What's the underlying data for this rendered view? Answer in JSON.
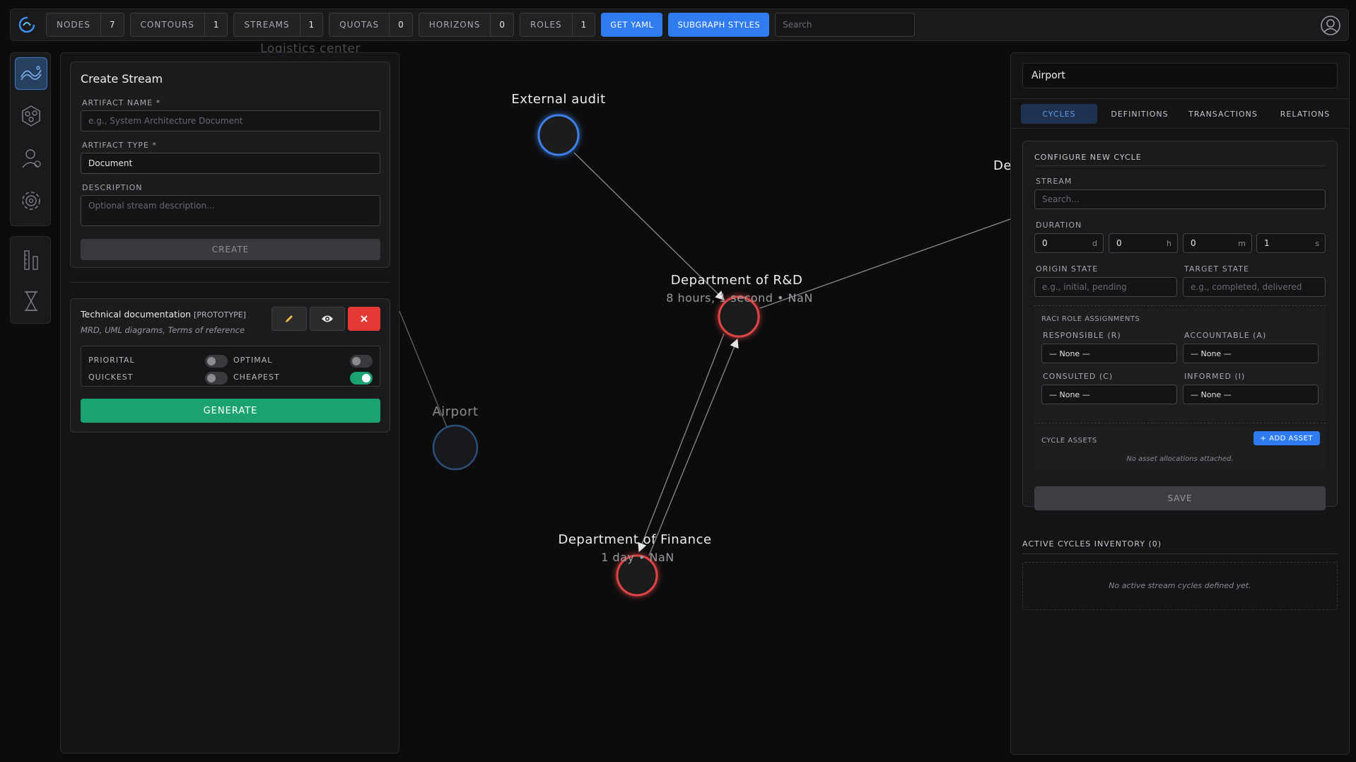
{
  "toolbar": {
    "pills": [
      {
        "label": "NODES",
        "count": "7"
      },
      {
        "label": "CONTOURS",
        "count": "1"
      },
      {
        "label": "STREAMS",
        "count": "1"
      },
      {
        "label": "QUOTAS",
        "count": "0"
      },
      {
        "label": "HORIZONS",
        "count": "0"
      },
      {
        "label": "ROLES",
        "count": "1"
      }
    ],
    "get_yaml": "GET YAML",
    "subgraph_styles": "SUBGRAPH STYLES",
    "search_placeholder": "Search"
  },
  "create_stream": {
    "title": "Create Stream",
    "artifact_name_label": "ARTIFACT NAME *",
    "artifact_name_placeholder": "e.g., System Architecture Document",
    "artifact_type_label": "ARTIFACT TYPE *",
    "artifact_type_value": "Document",
    "description_label": "DESCRIPTION",
    "description_placeholder": "Optional stream description...",
    "create_button": "CREATE"
  },
  "artifact_card": {
    "name": "Technical documentation",
    "tag": "[PROTOTYPE]",
    "subtitle": "MRD, UML diagrams, Terms of reference",
    "options": [
      {
        "label": "PRIORITAL",
        "on": false
      },
      {
        "label": "OPTIMAL",
        "on": false
      },
      {
        "label": "QUICKEST",
        "on": false
      },
      {
        "label": "CHEAPEST",
        "on": true
      }
    ],
    "generate_button": "GENERATE"
  },
  "graph": {
    "partial_top_label": "Logistics center",
    "partial_right_label": "De",
    "nodes": [
      {
        "label": "External audit",
        "sub": ""
      },
      {
        "label": "Department of R&D",
        "sub": "8 hours, 1 second • NaN"
      },
      {
        "label": "Airport",
        "sub": ""
      },
      {
        "label": "Department of Finance",
        "sub": "1 day • NaN"
      }
    ]
  },
  "detail": {
    "title": "Airport",
    "tabs": [
      "CYCLES",
      "DEFINITIONS",
      "TRANSACTIONS",
      "RELATIONS"
    ],
    "configure_title": "CONFIGURE NEW CYCLE",
    "stream_label": "STREAM",
    "stream_placeholder": "Search...",
    "duration_label": "DURATION",
    "duration": [
      {
        "value": "0",
        "unit": "d"
      },
      {
        "value": "0",
        "unit": "h"
      },
      {
        "value": "0",
        "unit": "m"
      },
      {
        "value": "1",
        "unit": "s"
      }
    ],
    "origin_label": "ORIGIN STATE",
    "origin_placeholder": "e.g., initial, pending",
    "target_label": "TARGET STATE",
    "target_placeholder": "e.g., completed, delivered",
    "raci_title": "RACI ROLE ASSIGNMENTS",
    "raci": [
      {
        "label": "RESPONSIBLE (R)",
        "value": "— None —"
      },
      {
        "label": "ACCOUNTABLE (A)",
        "value": "— None —"
      },
      {
        "label": "CONSULTED (C)",
        "value": "— None —"
      },
      {
        "label": "INFORMED (I)",
        "value": "— None —"
      }
    ],
    "assets_title": "CYCLE ASSETS",
    "add_asset": "+ ADD ASSET",
    "assets_empty": "No asset allocations attached.",
    "save_button": "SAVE",
    "inventory_title": "ACTIVE CYCLES INVENTORY (0)",
    "inventory_empty": "No active stream cycles defined yet."
  },
  "colors": {
    "accent_blue": "#2f7bf0",
    "accent_green": "#1aa371",
    "danger_red": "#e53935",
    "node_blue": "#3d7fe6",
    "node_red": "#e04545"
  }
}
